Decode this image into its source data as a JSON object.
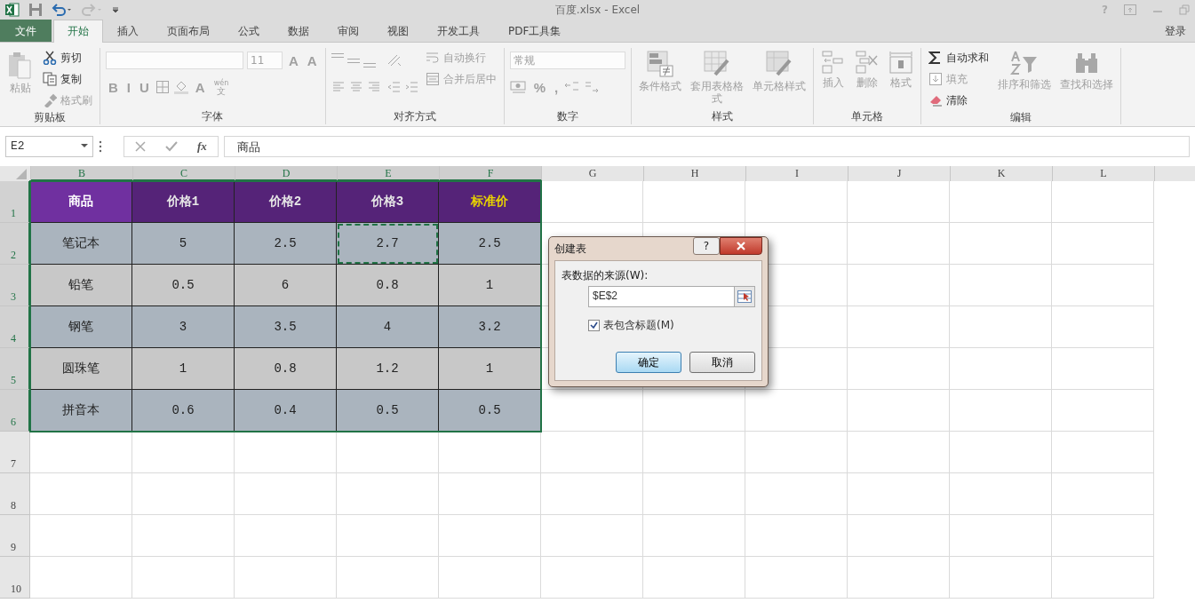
{
  "window": {
    "title": "百度.xlsx - Excel",
    "help": "?"
  },
  "tabs": [
    {
      "label": "文件",
      "kind": "file",
      "selected": false
    },
    {
      "label": "开始",
      "kind": "tab",
      "selected": true
    },
    {
      "label": "插入",
      "kind": "tab",
      "selected": false
    },
    {
      "label": "页面布局",
      "kind": "tab",
      "selected": false
    },
    {
      "label": "公式",
      "kind": "tab",
      "selected": false
    },
    {
      "label": "数据",
      "kind": "tab",
      "selected": false
    },
    {
      "label": "审阅",
      "kind": "tab",
      "selected": false
    },
    {
      "label": "视图",
      "kind": "tab",
      "selected": false
    },
    {
      "label": "开发工具",
      "kind": "tab",
      "selected": false
    },
    {
      "label": "PDF工具集",
      "kind": "tab",
      "selected": false
    }
  ],
  "sign_in": "登录",
  "ribbon": [
    {
      "label": "剪贴板",
      "columns": [
        [
          {
            "kind": "paste",
            "label": "粘贴",
            "disabled": true
          }
        ],
        [
          {
            "kind": "cut",
            "label": "剪切",
            "disabled": false
          },
          {
            "kind": "copy",
            "label": "复制",
            "disabled": false
          },
          {
            "kind": "brush",
            "label": "格式刷",
            "disabled": true
          }
        ]
      ]
    },
    {
      "label": "字体",
      "columns": [
        [
          {
            "kind": "line",
            "items": [
              {
                "kind": "font-combo",
                "disabled": true
              },
              {
                "kind": "size-combo",
                "value": "11",
                "disabled": true
              },
              {
                "kind": "glyph",
                "label": "A",
                "disabled": true
              },
              {
                "kind": "glyph",
                "label": "A",
                "disabled": true
              }
            ]
          },
          {
            "kind": "line",
            "items": [
              {
                "kind": "glyph",
                "label": "B",
                "disabled": true
              },
              {
                "kind": "glyph",
                "label": "I",
                "disabled": true
              },
              {
                "kind": "glyph",
                "label": "U",
                "disabled": true
              },
              {
                "kind": "borders",
                "disabled": true
              },
              {
                "kind": "fill",
                "disabled": true
              },
              {
                "kind": "glyph",
                "label": "A",
                "disabled": true
              },
              {
                "kind": "phonetic",
                "top": "wén",
                "bottom": "文",
                "disabled": true
              }
            ]
          }
        ]
      ]
    },
    {
      "label": "对齐方式",
      "columns": [
        [
          {
            "kind": "line",
            "items": [
              {
                "kind": "align-top",
                "disabled": true
              },
              {
                "kind": "align-middle",
                "disabled": true
              },
              {
                "kind": "align-bottom",
                "disabled": true
              }
            ]
          },
          {
            "kind": "line",
            "items": [
              {
                "kind": "align-left",
                "disabled": true
              },
              {
                "kind": "align-center",
                "disabled": true
              },
              {
                "kind": "align-right",
                "disabled": true
              }
            ]
          }
        ],
        [
          {
            "kind": "line",
            "items": [
              {
                "kind": "orient",
                "disabled": true
              }
            ]
          },
          {
            "kind": "line",
            "items": [
              {
                "kind": "indent-less",
                "disabled": true
              },
              {
                "kind": "indent-more",
                "disabled": true
              }
            ]
          }
        ],
        [
          {
            "kind": "wrap",
            "label": "自动换行",
            "disabled": true
          },
          {
            "kind": "merge",
            "label": "合并后居中",
            "disabled": true
          }
        ]
      ]
    },
    {
      "label": "数字",
      "columns": [
        [
          {
            "kind": "line",
            "items": [
              {
                "kind": "number-combo",
                "value": "常规",
                "disabled": true
              }
            ]
          },
          {
            "kind": "line",
            "items": [
              {
                "kind": "currency",
                "disabled": true
              },
              {
                "kind": "glyph",
                "label": "%",
                "disabled": true
              },
              {
                "kind": "glyph",
                "label": ",",
                "disabled": true
              },
              {
                "kind": "decimal-more",
                "disabled": true
              },
              {
                "kind": "decimal-less",
                "disabled": true
              }
            ]
          }
        ]
      ]
    },
    {
      "label": "样式",
      "columns": [
        [
          {
            "kind": "conditional",
            "label": "条件格式",
            "disabled": true
          }
        ],
        [
          {
            "kind": "table-format",
            "label": "套用表格格式",
            "disabled": true
          }
        ],
        [
          {
            "kind": "cell-style",
            "label": "单元格样式",
            "disabled": true
          }
        ]
      ]
    },
    {
      "label": "单元格",
      "columns": [
        [
          {
            "kind": "insert",
            "label": "插入",
            "disabled": true
          }
        ],
        [
          {
            "kind": "delete",
            "label": "删除",
            "disabled": true
          }
        ],
        [
          {
            "kind": "format",
            "label": "格式",
            "disabled": true
          }
        ]
      ]
    },
    {
      "label": "编辑",
      "columns": [
        [
          {
            "kind": "sum",
            "label": "自动求和",
            "disabled": false
          },
          {
            "kind": "fill-down",
            "label": "填充",
            "disabled": true
          },
          {
            "kind": "clear",
            "label": "清除",
            "disabled": false
          }
        ],
        [
          {
            "kind": "sort",
            "label": "排序和筛选",
            "disabled": true
          }
        ],
        [
          {
            "kind": "find",
            "label": "查找和选择",
            "disabled": true
          }
        ]
      ]
    }
  ],
  "formula_bar": {
    "name_box": "E2",
    "function_label": "fx",
    "value": "商品"
  },
  "columns": [
    {
      "label": "B",
      "selected": true
    },
    {
      "label": "C",
      "selected": true
    },
    {
      "label": "D",
      "selected": true
    },
    {
      "label": "E",
      "selected": true
    },
    {
      "label": "F",
      "selected": true
    },
    {
      "label": "G",
      "selected": false
    },
    {
      "label": "H",
      "selected": false
    },
    {
      "label": "I",
      "selected": false
    },
    {
      "label": "J",
      "selected": false
    },
    {
      "label": "K",
      "selected": false
    },
    {
      "label": "L",
      "selected": false
    }
  ],
  "rows": [
    {
      "label": "1",
      "selected": true,
      "cells": [
        {
          "text": "商品",
          "kind": "header-key",
          "marquee": false
        },
        {
          "text": "价格1",
          "kind": "header",
          "marquee": false
        },
        {
          "text": "价格2",
          "kind": "header",
          "marquee": false
        },
        {
          "text": "价格3",
          "kind": "header",
          "marquee": false
        },
        {
          "text": "标准价",
          "kind": "header-accent",
          "marquee": false
        }
      ]
    },
    {
      "label": "2",
      "selected": true,
      "cells": [
        {
          "text": "笔记本",
          "kind": "band-a",
          "marquee": false
        },
        {
          "text": "5",
          "kind": "band-a",
          "marquee": false
        },
        {
          "text": "2.5",
          "kind": "band-a",
          "marquee": false
        },
        {
          "text": "2.7",
          "kind": "band-a",
          "marquee": true
        },
        {
          "text": "2.5",
          "kind": "band-a",
          "marquee": false
        }
      ]
    },
    {
      "label": "3",
      "selected": true,
      "cells": [
        {
          "text": "铅笔",
          "kind": "band-b",
          "marquee": false
        },
        {
          "text": "0.5",
          "kind": "band-b",
          "marquee": false
        },
        {
          "text": "6",
          "kind": "band-b",
          "marquee": false
        },
        {
          "text": "0.8",
          "kind": "band-b",
          "marquee": false
        },
        {
          "text": "1",
          "kind": "band-b",
          "marquee": false
        }
      ]
    },
    {
      "label": "4",
      "selected": true,
      "cells": [
        {
          "text": "钢笔",
          "kind": "band-a",
          "marquee": false
        },
        {
          "text": "3",
          "kind": "band-a",
          "marquee": false
        },
        {
          "text": "3.5",
          "kind": "band-a",
          "marquee": false
        },
        {
          "text": "4",
          "kind": "band-a",
          "marquee": false
        },
        {
          "text": "3.2",
          "kind": "band-a",
          "marquee": false
        }
      ]
    },
    {
      "label": "5",
      "selected": true,
      "cells": [
        {
          "text": "圆珠笔",
          "kind": "band-b",
          "marquee": false
        },
        {
          "text": "1",
          "kind": "band-b",
          "marquee": false
        },
        {
          "text": "0.8",
          "kind": "band-b",
          "marquee": false
        },
        {
          "text": "1.2",
          "kind": "band-b",
          "marquee": false
        },
        {
          "text": "1",
          "kind": "band-b",
          "marquee": false
        }
      ]
    },
    {
      "label": "6",
      "selected": true,
      "cells": [
        {
          "text": "拼音本",
          "kind": "band-a",
          "marquee": false
        },
        {
          "text": "0.6",
          "kind": "band-a",
          "marquee": false
        },
        {
          "text": "0.4",
          "kind": "band-a",
          "marquee": false
        },
        {
          "text": "0.5",
          "kind": "band-a",
          "marquee": false
        },
        {
          "text": "0.5",
          "kind": "band-a",
          "marquee": false
        }
      ]
    },
    {
      "label": "7",
      "selected": false,
      "cells": []
    },
    {
      "label": "8",
      "selected": false,
      "cells": []
    },
    {
      "label": "9",
      "selected": false,
      "cells": []
    },
    {
      "label": "10",
      "selected": false,
      "cells": []
    }
  ],
  "dialog": {
    "title": "创建表",
    "help": "?",
    "source_label": "表数据的来源(W):",
    "source_value": "$E$2",
    "header_checkbox": {
      "label": "表包含标题(M)",
      "checked": true
    },
    "buttons": [
      {
        "label": "确定",
        "kind": "default"
      },
      {
        "label": "取消",
        "kind": "normal"
      }
    ]
  }
}
